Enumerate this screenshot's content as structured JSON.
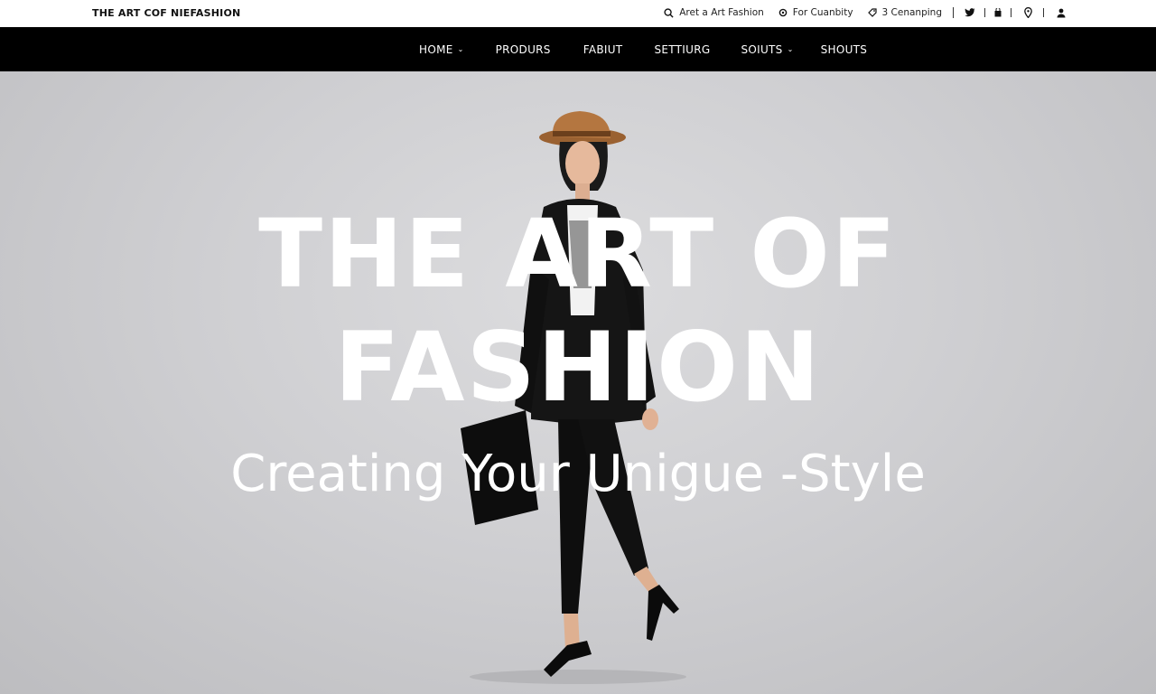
{
  "header": {
    "brand": "THE ART COF NIEFASHION",
    "search": {
      "label": "Aret a Art Fashion",
      "icon": "search-icon"
    },
    "utility_links": [
      {
        "label": "For Cuanbity",
        "icon": "gear-icon"
      },
      {
        "label": "3 Cenanping",
        "icon": "tag-icon"
      }
    ],
    "social": [
      {
        "icon": "twitter-icon"
      },
      {
        "icon": "bag-icon"
      },
      {
        "icon": "location-pin-icon"
      },
      {
        "icon": "user-icon"
      }
    ]
  },
  "nav": {
    "items": [
      {
        "label": "HOME",
        "has_dropdown": true
      },
      {
        "label": "PRODURS",
        "has_dropdown": false
      },
      {
        "label": "FABIUT",
        "has_dropdown": false
      },
      {
        "label": "SETTIURG",
        "has_dropdown": false
      },
      {
        "label": "SOIUTS",
        "has_dropdown": true
      },
      {
        "label": "SHOUTS",
        "has_dropdown": false
      }
    ]
  },
  "hero": {
    "line1": "THE ART OF",
    "line2": "FASHION",
    "tagline": "Creating Your Unigue -Style"
  },
  "colors": {
    "nav_bg": "#000000",
    "hero_bg": "#cfcfd2",
    "hat": "#b47640",
    "headline": "#ffffff"
  }
}
